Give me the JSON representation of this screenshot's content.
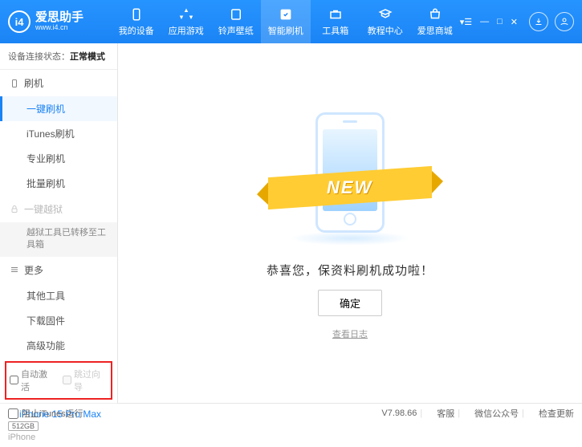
{
  "app": {
    "name": "爱思助手",
    "url": "www.i4.cn"
  },
  "topnav": [
    {
      "label": "我的设备"
    },
    {
      "label": "应用游戏"
    },
    {
      "label": "铃声壁纸"
    },
    {
      "label": "智能刷机"
    },
    {
      "label": "工具箱"
    },
    {
      "label": "教程中心"
    },
    {
      "label": "爱思商城"
    }
  ],
  "status": {
    "prefix": "设备连接状态：",
    "value": "正常模式"
  },
  "sidebar": {
    "flash_group": "刷机",
    "items": [
      "一键刷机",
      "iTunes刷机",
      "专业刷机",
      "批量刷机"
    ],
    "jailbreak_group": "一键越狱",
    "jailbreak_note": "越狱工具已转移至工具箱",
    "more_group": "更多",
    "more_items": [
      "其他工具",
      "下载固件",
      "高级功能"
    ]
  },
  "options": {
    "auto_activate": "自动激活",
    "skip_guide": "跳过向导"
  },
  "device": {
    "name": "iPhone 15 Pro Max",
    "storage": "512GB",
    "type": "iPhone"
  },
  "main": {
    "ribbon": "NEW",
    "message": "恭喜您，保资料刷机成功啦！",
    "ok": "确定",
    "log": "查看日志"
  },
  "footer": {
    "block_itunes": "阻止iTunes运行",
    "version": "V7.98.66",
    "links": [
      "客服",
      "微信公众号",
      "检查更新"
    ]
  }
}
